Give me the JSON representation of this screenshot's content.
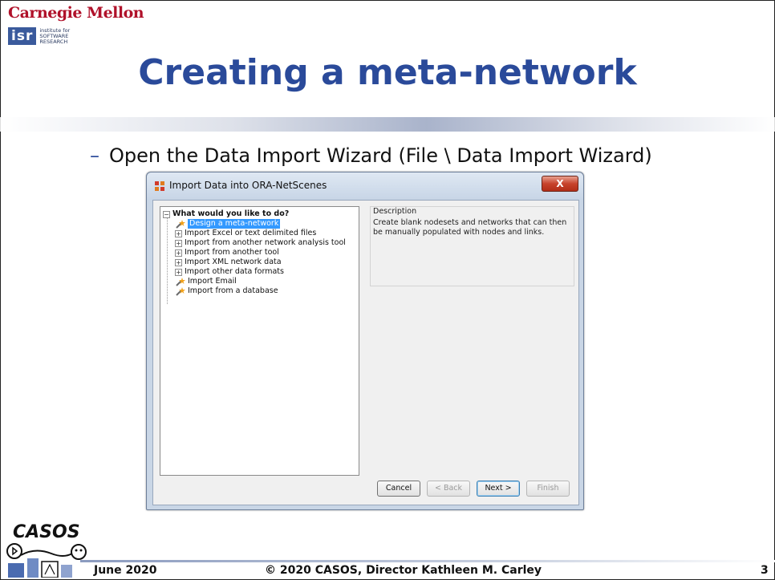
{
  "header": {
    "university": "Carnegie Mellon",
    "isr_abbrev": "isr",
    "isr_line1": "institute for",
    "isr_line2": "SOFTWARE",
    "isr_line3": "RESEARCH"
  },
  "slide": {
    "title": "Creating a meta-network",
    "bullet_dash": "–",
    "bullet_text": "Open the Data Import Wizard (File \\ Data Import Wizard)"
  },
  "dialog": {
    "title": "Import Data into ORA-NetScenes",
    "close_label": "X",
    "tree": {
      "root_label": "What would you like to do?",
      "items": [
        {
          "label": "Design a meta-network",
          "kind": "leaf",
          "selected": true
        },
        {
          "label": "Import Excel or text delimited files",
          "kind": "group"
        },
        {
          "label": "Import from another network analysis tool",
          "kind": "group"
        },
        {
          "label": "Import from another tool",
          "kind": "group"
        },
        {
          "label": "Import XML network data",
          "kind": "group"
        },
        {
          "label": "Import other data formats",
          "kind": "group"
        },
        {
          "label": "Import Email",
          "kind": "leaf"
        },
        {
          "label": "Import from a database",
          "kind": "leaf"
        }
      ]
    },
    "description": {
      "title": "Description",
      "text": "Create blank nodesets and networks that can then be manually populated with nodes and links."
    },
    "buttons": {
      "cancel": "Cancel",
      "back": "< Back",
      "next": "Next >",
      "finish": "Finish"
    }
  },
  "footer": {
    "casos_logo_text": "CASOS",
    "date": "June 2020",
    "copyright": "© 2020 CASOS, Director Kathleen M. Carley",
    "page_number": "3"
  },
  "colors": {
    "title_blue": "#2a4a9a",
    "cmu_red": "#b0112a",
    "selection_blue": "#3399ff",
    "close_red": "#c7432c"
  }
}
